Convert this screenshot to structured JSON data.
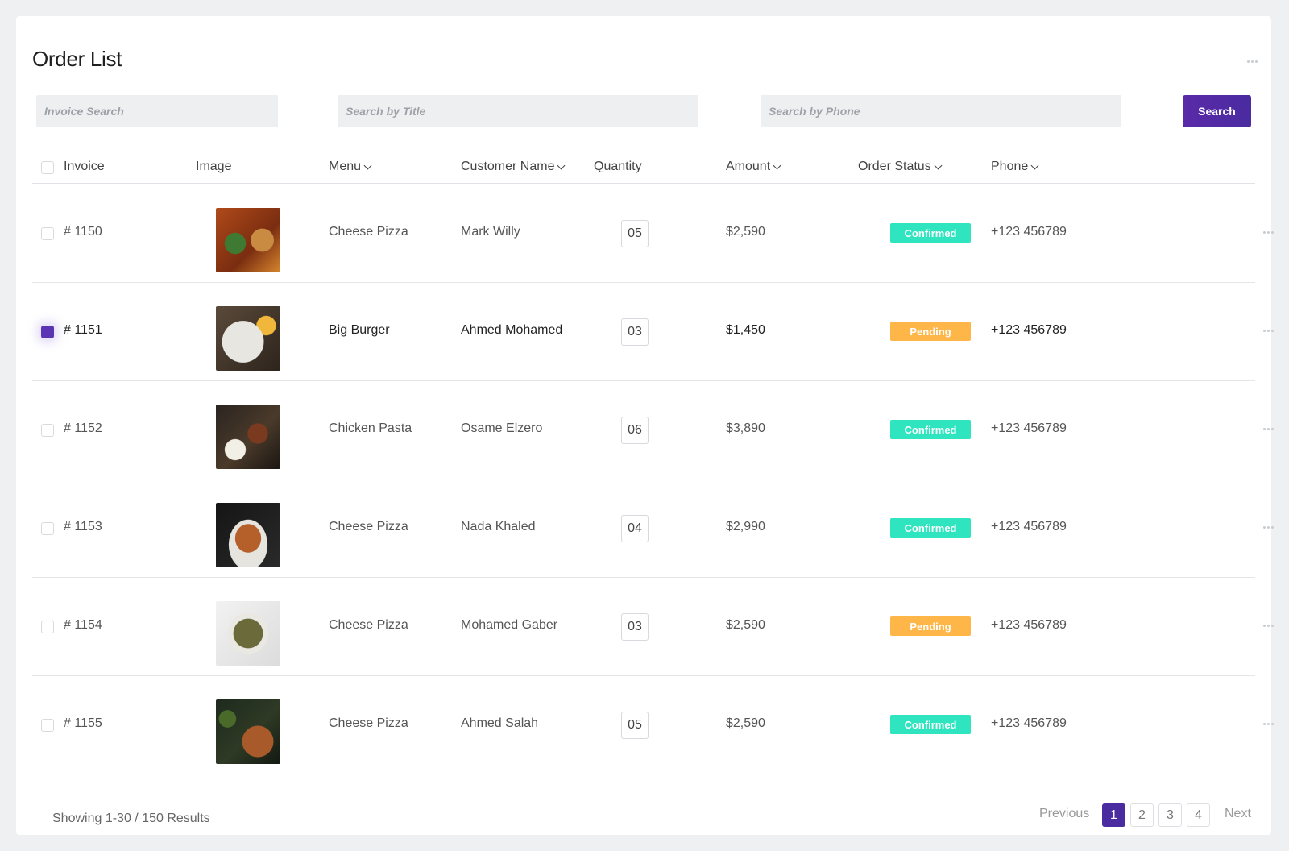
{
  "page": {
    "title": "Order List"
  },
  "search": {
    "invoice_placeholder": "Invoice Search",
    "title_placeholder": "Search by Title",
    "phone_placeholder": "Search by Phone",
    "button_label": "Search"
  },
  "table": {
    "columns": [
      "Invoice",
      "Image",
      "Menu",
      "Customer Name",
      "Quantity",
      "Amount",
      "Order Status",
      "Phone"
    ],
    "sortable": [
      "Menu",
      "Customer Name",
      "Amount",
      "Order Status",
      "Phone"
    ],
    "rows": [
      {
        "invoice": "# 1150",
        "image": "food-photo",
        "menu": "Cheese Pizza",
        "customer": "Mark Willy",
        "quantity": "05",
        "amount": "$2,590",
        "status": "Confirmed",
        "phone": "+123 456789",
        "checked": false
      },
      {
        "invoice": "# 1151",
        "image": "food-photo",
        "menu": "Big Burger",
        "customer": "Ahmed Mohamed",
        "quantity": "03",
        "amount": "$1,450",
        "status": "Pending",
        "phone": "+123 456789",
        "checked": true
      },
      {
        "invoice": "# 1152",
        "image": "food-photo",
        "menu": "Chicken Pasta",
        "customer": "Osame Elzero",
        "quantity": "06",
        "amount": "$3,890",
        "status": "Confirmed",
        "phone": "+123 456789",
        "checked": false
      },
      {
        "invoice": "# 1153",
        "image": "food-photo",
        "menu": "Cheese Pizza",
        "customer": "Nada Khaled",
        "quantity": "04",
        "amount": "$2,990",
        "status": "Confirmed",
        "phone": "+123 456789",
        "checked": false
      },
      {
        "invoice": "# 1154",
        "image": "food-photo",
        "menu": "Cheese Pizza",
        "customer": "Mohamed Gaber",
        "quantity": "03",
        "amount": "$2,590",
        "status": "Pending",
        "phone": "+123 456789",
        "checked": false
      },
      {
        "invoice": "# 1155",
        "image": "food-photo",
        "menu": "Cheese Pizza",
        "customer": "Ahmed Salah",
        "quantity": "05",
        "amount": "$2,590",
        "status": "Confirmed",
        "phone": "+123 456789",
        "checked": false
      }
    ]
  },
  "footer": {
    "showing": "Showing 1-30 / 150 Results",
    "pagination": {
      "previous": "Previous",
      "pages": [
        "1",
        "2",
        "3",
        "4"
      ],
      "current": "1",
      "next": "Next"
    }
  },
  "colors": {
    "accent": "#4a2ba0",
    "confirmed": "#2ee5c0",
    "pending": "#ffb649",
    "background": "#eef0f2"
  }
}
